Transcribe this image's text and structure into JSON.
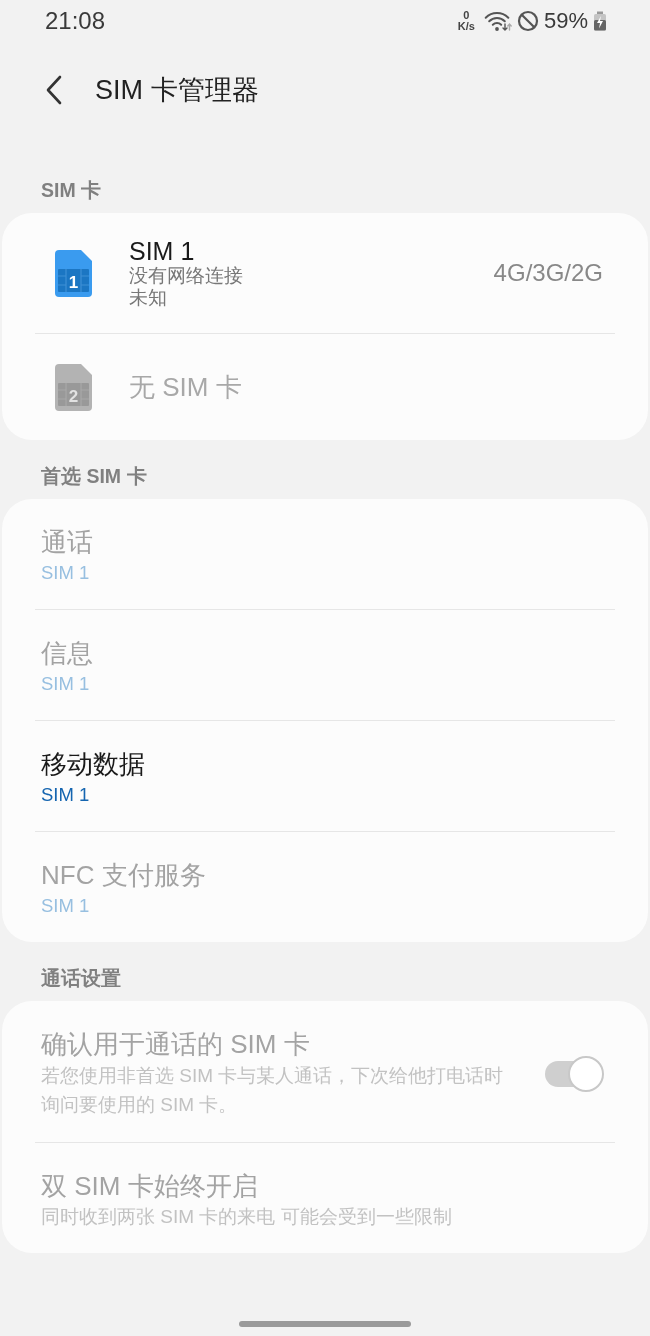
{
  "status_bar": {
    "time": "21:08",
    "speed_value": "0",
    "speed_unit": "K/s",
    "battery": "59%"
  },
  "header": {
    "title": "SIM 卡管理器"
  },
  "sections": [
    {
      "label": "SIM 卡",
      "items": [
        {
          "kind": "sim",
          "slot": "1",
          "title": "SIM 1",
          "details": [
            "没有网络连接",
            "未知"
          ],
          "network": "4G/3G/2G",
          "disabled": false
        },
        {
          "kind": "sim",
          "slot": "2",
          "title": "无 SIM 卡",
          "disabled": true
        }
      ]
    },
    {
      "label": "首选 SIM 卡",
      "items": [
        {
          "kind": "choice",
          "title": "通话",
          "value": "SIM 1",
          "disabled": true
        },
        {
          "kind": "choice",
          "title": "信息",
          "value": "SIM 1",
          "disabled": true
        },
        {
          "kind": "choice",
          "title": "移动数据",
          "value": "SIM 1",
          "disabled": false
        },
        {
          "kind": "choice",
          "title": "NFC 支付服务",
          "value": "SIM 1",
          "disabled": true
        }
      ]
    },
    {
      "label": "通话设置",
      "items": [
        {
          "kind": "toggle",
          "title": "确认用于通话的 SIM 卡",
          "description": "若您使用非首选 SIM 卡与某人通话，下次给他打电话时询问要使用的 SIM 卡。",
          "on": true,
          "disabled": true
        },
        {
          "kind": "text",
          "title": "双 SIM 卡始终开启",
          "description": "同时收到两张 SIM 卡的来电 可能会受到一些限制",
          "disabled": true
        }
      ]
    }
  ]
}
